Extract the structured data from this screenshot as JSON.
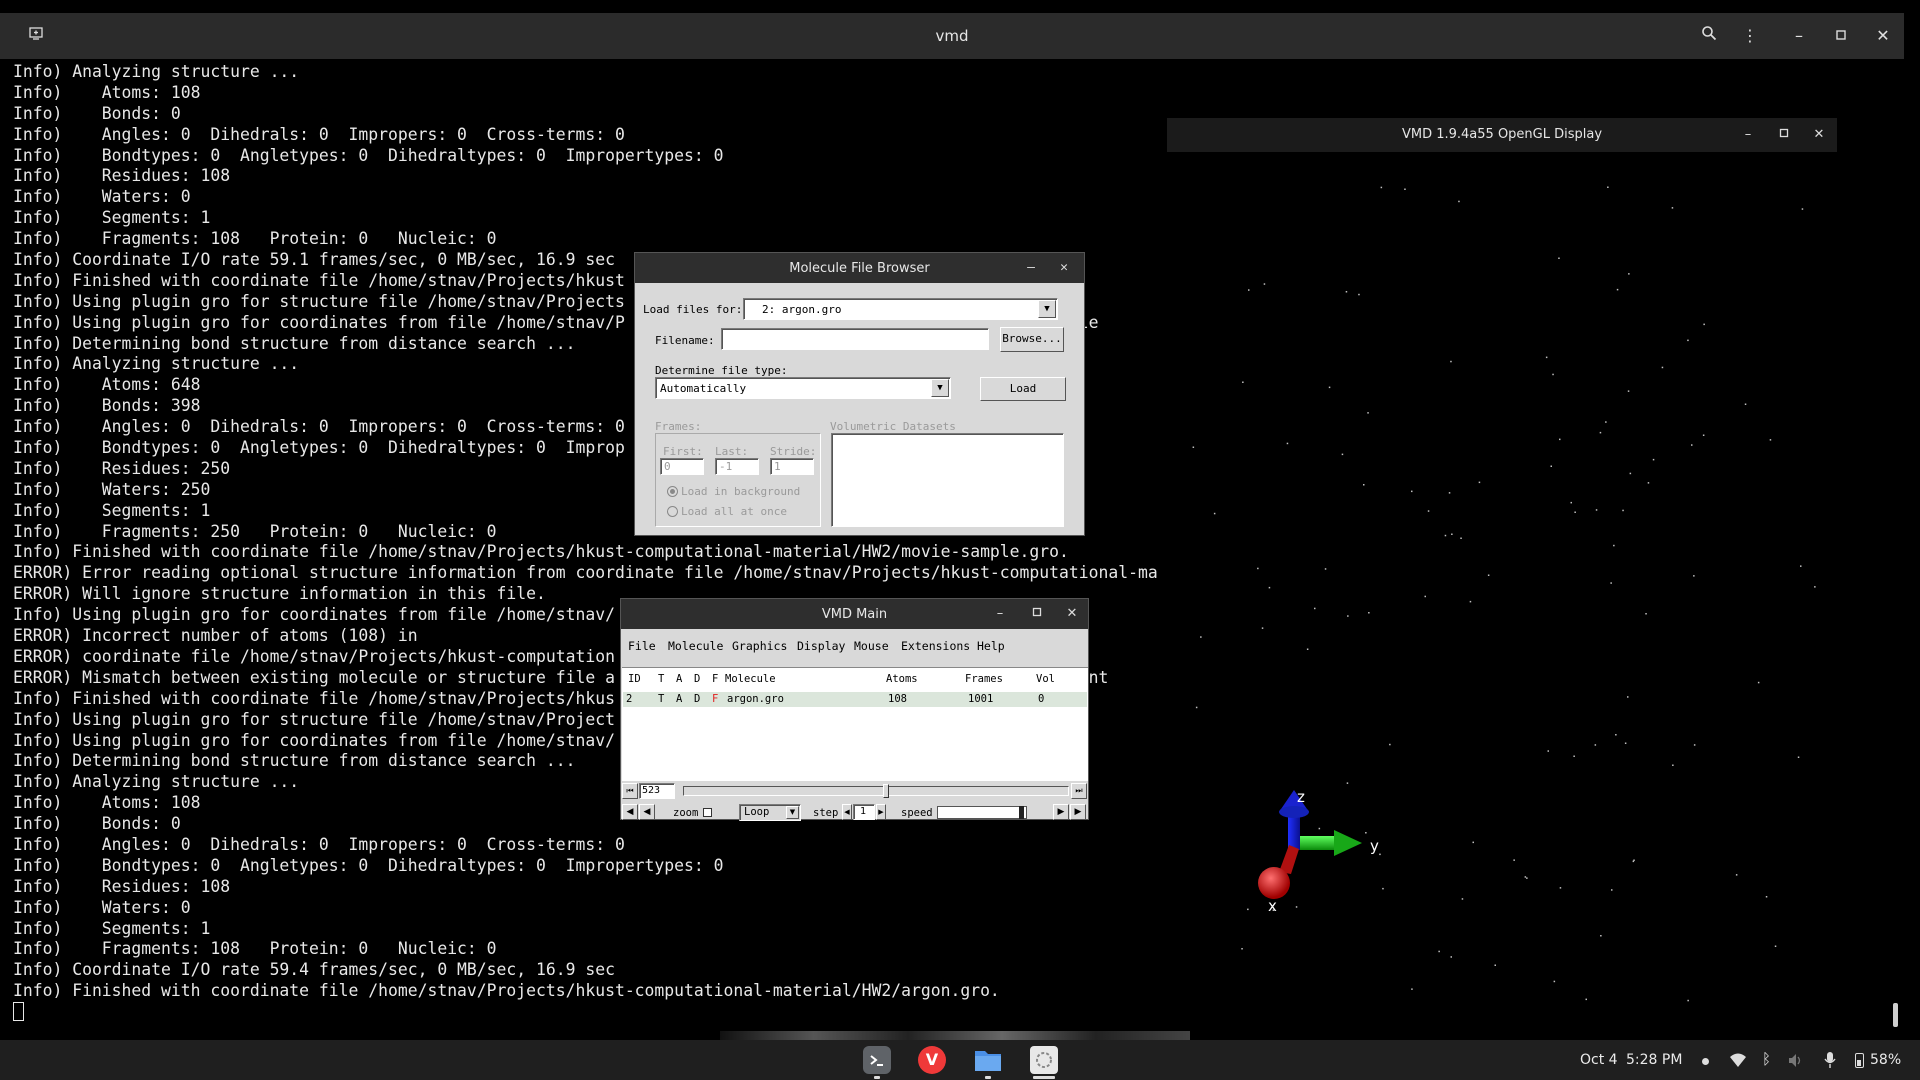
{
  "terminal": {
    "title": "vmd",
    "lines": [
      "Info) Analyzing structure ...",
      "Info)    Atoms: 108",
      "Info)    Bonds: 0",
      "Info)    Angles: 0  Dihedrals: 0  Impropers: 0  Cross-terms: 0",
      "Info)    Bondtypes: 0  Angletypes: 0  Dihedraltypes: 0  Impropertypes: 0",
      "Info)    Residues: 108",
      "Info)    Waters: 0",
      "Info)    Segments: 1",
      "Info)    Fragments: 108   Protein: 0   Nucleic: 0",
      "Info) Coordinate I/O rate 59.1 frames/sec, 0 MB/sec, 16.9 sec",
      "Info) Finished with coordinate file /home/stnav/Projects/hkust",
      "Info) Using plugin gro for structure file /home/stnav/Projects                                        .gro",
      "Info) Using plugin gro for coordinates from file /home/stnav/P                                        e-sample",
      "Info) Determining bond structure from distance search ...",
      "Info) Analyzing structure ...",
      "Info)    Atoms: 648",
      "Info)    Bonds: 398",
      "Info)    Angles: 0  Dihedrals: 0  Impropers: 0  Cross-terms: 0",
      "Info)    Bondtypes: 0  Angletypes: 0  Dihedraltypes: 0  Improp",
      "Info)    Residues: 250",
      "Info)    Waters: 250",
      "Info)    Segments: 1",
      "Info)    Fragments: 250   Protein: 0   Nucleic: 0",
      "Info) Finished with coordinate file /home/stnav/Projects/hkust-computational-material/HW2/movie-sample.gro.",
      "ERROR) Error reading optional structure information from coordinate file /home/stnav/Projects/hkust-computational-ma",
      "ERROR) Will ignore structure information in this file.",
      "Info) Using plugin gro for coordinates from file /home/stnav/                                          n.gro",
      "ERROR) Incorrect number of atoms (108) in",
      "ERROR) coordinate file /home/stnav/Projects/hkust-computation",
      "ERROR) Mismatch between existing molecule or structure file a                                          om count",
      "Info) Finished with coordinate file /home/stnav/Projects/hkus",
      "Info) Using plugin gro for structure file /home/stnav/Project",
      "Info) Using plugin gro for coordinates from file /home/stnav/                                          n.gro",
      "Info) Determining bond structure from distance search ...",
      "Info) Analyzing structure ...",
      "Info)    Atoms: 108",
      "Info)    Bonds: 0",
      "Info)    Angles: 0  Dihedrals: 0  Impropers: 0  Cross-terms: 0",
      "Info)    Bondtypes: 0  Angletypes: 0  Dihedraltypes: 0  Impropertypes: 0",
      "Info)    Residues: 108",
      "Info)    Waters: 0",
      "Info)    Segments: 1",
      "Info)    Fragments: 108   Protein: 0   Nucleic: 0",
      "Info) Coordinate I/O rate 59.4 frames/sec, 0 MB/sec, 16.9 sec",
      "Info) Finished with coordinate file /home/stnav/Projects/hkust-computational-material/HW2/argon.gro."
    ]
  },
  "gl_display": {
    "title": "VMD 1.9.4a55 OpenGL Display",
    "axes": {
      "x": "x",
      "y": "y",
      "z": "z"
    },
    "colors": {
      "x_axis": "#d01818",
      "y_axis": "#1cb81c",
      "z_axis": "#1a2adf"
    }
  },
  "file_browser": {
    "title": "Molecule File Browser",
    "load_files_for_label": "Load files for:",
    "load_files_for_value": "2: argon.gro",
    "filename_label": "Filename:",
    "filename_value": "",
    "browse_label": "Browse...",
    "file_type_label": "Determine file type:",
    "file_type_value": "Automatically",
    "load_label": "Load",
    "frames_label": "Frames:",
    "first_label": "First:",
    "first_value": "0",
    "last_label": "Last:",
    "last_value": "-1",
    "stride_label": "Stride:",
    "stride_value": "1",
    "load_background_label": "Load in background",
    "load_all_label": "Load all at once",
    "volumetric_label": "Volumetric Datasets"
  },
  "vmd_main": {
    "title": "VMD Main",
    "menu": [
      "File",
      "Molecule",
      "Graphics",
      "Display",
      "Mouse",
      "Extensions",
      "Help"
    ],
    "columns": {
      "id": "ID",
      "t": "T",
      "a": "A",
      "d": "D",
      "f": "F",
      "molecule": "Molecule",
      "atoms": "Atoms",
      "frames": "Frames",
      "vol": "Vol"
    },
    "row": {
      "id": "2",
      "t": "T",
      "a": "A",
      "d": "D",
      "f": "F",
      "molecule": "argon.gro",
      "atoms": "108",
      "frames": "1001",
      "vol": "0"
    },
    "frame_value": "523",
    "frame_fraction": 0.523,
    "zoom_label": "zoom",
    "loop_value": "Loop",
    "step_label": "step",
    "step_value": "1",
    "speed_label": "speed",
    "f_color": "#e02020"
  },
  "taskbar": {
    "date": "Oct 4",
    "time": "5:28 PM",
    "battery": "58%"
  }
}
